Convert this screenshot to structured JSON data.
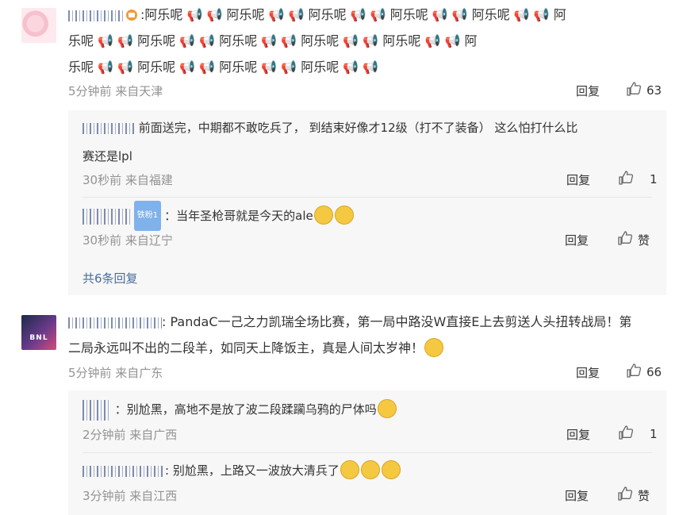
{
  "comments": [
    {
      "user": "\\\\-\\~J\\~\\~\\\\\\'!",
      "text": "阿乐呢阿乐呢阿乐呢阿乐呢阿乐呢阿乐呢阿乐呢阿乐呢阿乐呢阿乐呢阿乐呢阿乐呢阿乐呢阿乐呢阿乐呢阿乐呢",
      "line1": ":阿乐呢 📢 📢 阿乐呢 📢 📢 阿乐呢 📢 📢 阿乐呢 📢 📢 阿乐呢 📢 📢 阿",
      "line2": "乐呢 📢 📢 阿乐呢 📢 📢 阿乐呢 📢 📢 阿乐呢 📢 📢 阿乐呢 📢 📢 阿",
      "line3": "乐呢 📢 📢 阿乐呢 📢 📢 阿乐呢 📢 📢 阿乐呢 📢 📢",
      "meta": "5分钟前 来自天津",
      "reply_label": "回复",
      "like_count": "63",
      "replies": [
        {
          "text_line1": "前面送完，中期都不敢吃兵了， 到结束好像才12级（打不了装备） 这么怕打什么比",
          "text_line2": "赛还是lpl",
          "meta": "30秒前 来自福建",
          "reply_label": "回复",
          "like_count": "1"
        },
        {
          "badge": "铁粉1",
          "text": "：当年圣枪哥就是今天的ale",
          "meta": "30秒前 来自辽宁",
          "reply_label": "回复",
          "like_label": "赞"
        }
      ],
      "more": "共6条回复"
    },
    {
      "text_line1": ": PandaC一己之力凯瑞全场比赛，第一局中路没W直接E上去剪送人头扭转战局！第",
      "text_line2": "二局永远叫不出的二段羊，如同天上降饭主，真是人间太岁神！",
      "meta": "5分钟前 来自广东",
      "reply_label": "回复",
      "like_count": "66",
      "replies": [
        {
          "text": "：别尬黑，高地不是放了波二段蹂躏乌鸦的尸体吗",
          "meta": "2分钟前 来自广西",
          "reply_label": "回复",
          "like_count": "1"
        },
        {
          "text": ": 别尬黑，上路又一波放大清兵了",
          "meta": "3分钟前 来自江西",
          "reply_label": "回复",
          "like_label": "赞"
        }
      ]
    }
  ],
  "colors": {
    "link": "#476c9e",
    "meta": "#939393",
    "reply_bg": "#f7f7f7"
  },
  "icons": [
    "megaphone-icon",
    "thumbs-up-icon",
    "smile-emoji-icon",
    "cry-laugh-emoji-icon"
  ]
}
